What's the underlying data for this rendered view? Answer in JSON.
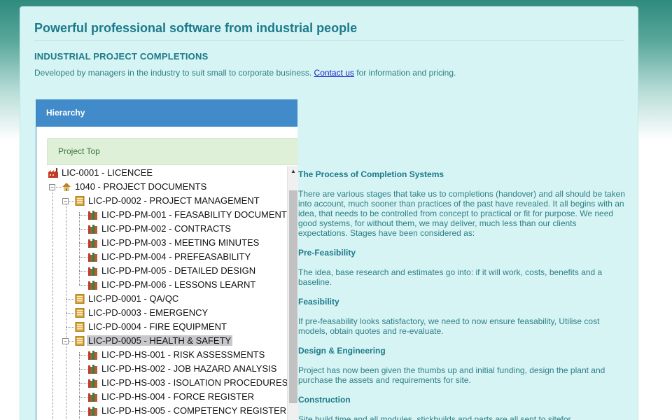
{
  "page": {
    "title": "Powerful professional software from industrial people",
    "subtitle": "INDUSTRIAL PROJECT COMPLETIONS",
    "intro_before": "Developed by managers in the industry to suit small to corporate business. ",
    "intro_link": "Contact us",
    "intro_after": " for information and pricing."
  },
  "hierarchy": {
    "header": "Hierarchy",
    "top_label": "Project Top",
    "rows": [
      {
        "label": "LIC-0001 - LICENCEE",
        "icon": "factory-icon"
      },
      {
        "label": "1040 - PROJECT DOCUMENTS",
        "icon": "house-icon"
      },
      {
        "label": "LIC-PD-0002 - PROJECT MANAGEMENT",
        "icon": "folder-stack-icon"
      },
      {
        "label": "LIC-PD-PM-001 - FEASABILITY DOCUMENT",
        "icon": "books-icon"
      },
      {
        "label": "LIC-PD-PM-002 - CONTRACTS",
        "icon": "books-icon"
      },
      {
        "label": "LIC-PD-PM-003 - MEETING MINUTES",
        "icon": "books-icon"
      },
      {
        "label": "LIC-PD-PM-004 - PREFEASABILITY",
        "icon": "books-icon"
      },
      {
        "label": "LIC-PD-PM-005 - DETAILED DESIGN",
        "icon": "books-icon"
      },
      {
        "label": "LIC-PD-PM-006 - LESSONS LEARNT",
        "icon": "books-icon"
      },
      {
        "label": "LIC-PD-0001 - QA/QC",
        "icon": "folder-stack-icon"
      },
      {
        "label": "LIC-PD-0003 - EMERGENCY",
        "icon": "folder-stack-icon"
      },
      {
        "label": "LIC-PD-0004 - FIRE EQUIPMENT",
        "icon": "folder-stack-icon"
      },
      {
        "label": "LIC-PD-0005 - HEALTH & SAFETY",
        "icon": "folder-stack-icon",
        "selected": true
      },
      {
        "label": "LIC-PD-HS-001 - RISK ASSESSMENTS",
        "icon": "books-icon"
      },
      {
        "label": "LIC-PD-HS-002 - JOB HAZARD ANALYSIS",
        "icon": "books-icon"
      },
      {
        "label": "LIC-PD-HS-003 - ISOLATION PROCEDURES",
        "icon": "books-icon"
      },
      {
        "label": "LIC-PD-HS-004 - FORCE REGISTER",
        "icon": "books-icon"
      },
      {
        "label": "LIC-PD-HS-005 - COMPETENCY REGISTER",
        "icon": "books-icon"
      }
    ],
    "scroll_position": 0.25
  },
  "content": {
    "heading": "The Process of Completion Systems",
    "intro": "There are various stages that take us to completions (handover) and all should be taken into account, much sooner than practices of the past have revealed. It all begins with an idea, that needs to be controlled from concept to practical or fit for purpose. We need good systems, for without them, we may deliver, much less than our clients expectations. Stages have been considered as:",
    "sections": [
      {
        "title": "Pre-Feasibility",
        "text": "The idea, base research and estimates go into: if it will work, costs, benefits and a baseline."
      },
      {
        "title": "Feasibility",
        "text": "If pre-feasability looks satisfactory, we need to now ensure feasability, Utilise cost models, obtain quotes and re-evaluate."
      },
      {
        "title": "Design & Engineering",
        "text": "Project has now been given the thumbs up and initial funding, design the plant and purchase the assets and requirements for site."
      },
      {
        "title": "Construction",
        "text": "Site build time and all modules, stickbuilds and parts are all sent to sitefor"
      }
    ]
  }
}
